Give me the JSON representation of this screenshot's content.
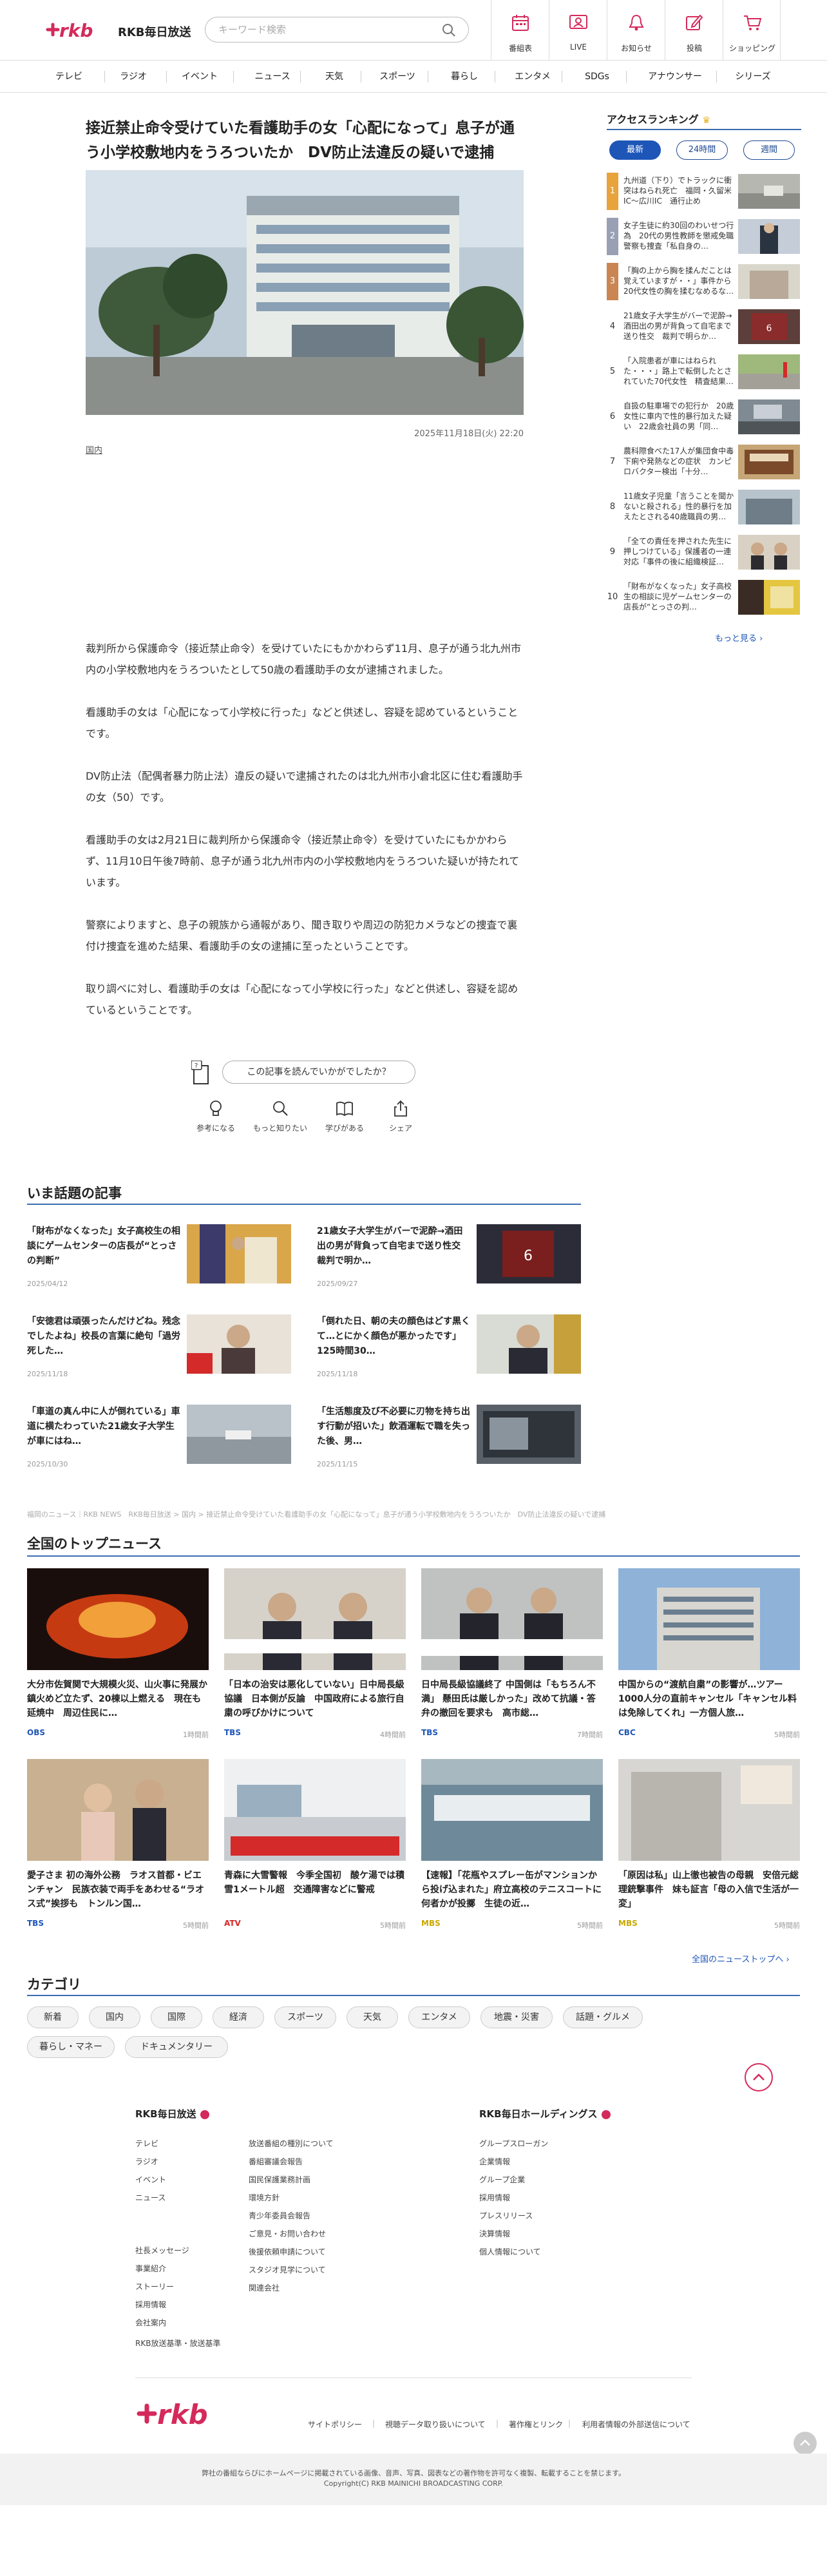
{
  "header": {
    "brand": "RKB毎日放送",
    "search_placeholder": "キーワード検索",
    "nav": [
      "番組表",
      "LIVE",
      "お知らせ",
      "投稿",
      "ショッピング"
    ]
  },
  "global_nav": [
    "テレビ",
    "ラジオ",
    "イベント",
    "ニュース",
    "天気",
    "スポーツ",
    "暮らし",
    "エンタメ",
    "SDGs",
    "アナウンサー",
    "シリーズ"
  ],
  "article": {
    "title": "接近禁止命令受けていた看護助手の女「心配になって」息子が通う小学校敷地内をうろついたか　DV防止法違反の疑いで逮捕",
    "date": "2025年11月18日(火) 22:20",
    "category": "国内",
    "paragraphs": [
      "裁判所から保護命令（接近禁止命令）を受けていたにもかかわらず11月、息子が通う北九州市内の小学校敷地内をうろついたとして50歳の看護助手の女が逮捕されました。",
      "看護助手の女は「心配になって小学校に行った」などと供述し、容疑を認めているということです。",
      "DV防止法（配偶者暴力防止法）違反の疑いで逮捕されたのは北九州市小倉北区に住む看護助手の女（50）です。",
      "看護助手の女は2月21日に裁判所から保護命令（接近禁止命令）を受けていたにもかかわらず、11月10日午後7時前、息子が通う北九州市内の小学校敷地内をうろついた疑いが持たれています。",
      "警察によりますと、息子の親族から通報があり、聞き取りや周辺の防犯カメラなどの捜査で裏付け捜査を進めた結果、看護助手の女の逮捕に至ったということです。",
      "取り調べに対し、看護助手の女は「心配になって小学校に行った」などと供述し、容疑を認めているということです。"
    ],
    "poll_question": "この記事を読んでいかがでしたか？",
    "reactions": [
      "参考になる",
      "もっと知りたい",
      "学びがある",
      "シェア"
    ]
  },
  "ranking": {
    "title": "アクセスランキング",
    "tabs": [
      "最新",
      "24時間",
      "週間"
    ],
    "active_tab": "最新",
    "items": [
      {
        "num": "1",
        "text": "九州道（下り）でトラックに衝突はねられ死亡　福岡・久留米IC～広川IC　通行止め"
      },
      {
        "num": "2",
        "text": "女子生徒に約30回のわいせつ行為　20代の男性教師を懲戒免職　警察も捜査「私自身の…"
      },
      {
        "num": "3",
        "text": "「胸の上から胸を揉んだことは覚えていますが・・」事件から20代女性の胸を揉むなめるな…"
      },
      {
        "num": "4",
        "text": "21歳女子大学生がバーで泥酔→酒田出の男が背負って自宅まで送り性交　裁判で明らか…"
      },
      {
        "num": "5",
        "text": "「入院患者が車にはねられた・・・」路上で転倒したとされていた70代女性　精査結果…"
      },
      {
        "num": "6",
        "text": "自扱の駐車場での犯行か　20歳女性に車内で性的暴行加えた疑い　22歳会社員の男「同…"
      },
      {
        "num": "7",
        "text": "農科際食べた17人が集団食中毒　下痢や発熱などの症状　カンピロバクター検出「十分…"
      },
      {
        "num": "8",
        "text": "11歳女子児童「言うことを聞かないと殺される」性的暴行を加えたとされる40歳職員の男…"
      },
      {
        "num": "9",
        "text": "「全ての責任を押された先生に押しつけている」保護者の一連対応「事件の後に組織検証…"
      },
      {
        "num": "10",
        "text": "「財布がなくなった」女子高校生の相談に児ゲームセンターの店長が“とっさの判…"
      }
    ],
    "more": "もっと見る"
  },
  "trending": {
    "title": "いま話題の記事",
    "items": [
      {
        "title": "「財布がなくなった」女子高校生の相談にゲームセンターの店長が“とっさの判断”",
        "date": "2025/04/12"
      },
      {
        "title": "21歳女子大学生がバーで泥酔→酒田出の男が背負って自宅まで送り性交　裁判で明か…",
        "date": "2025/09/27"
      },
      {
        "title": "「安徳君は頑張ったんだけどね。残念でしたよね」校長の言葉に絶句「過労死した…",
        "date": "2025/11/18"
      },
      {
        "title": "「倒れた日、朝の夫の顔色はどす黒くて…とにかく顔色が悪かったです」125時間30…",
        "date": "2025/11/18"
      },
      {
        "title": "「車道の真ん中に人が倒れている」車道に横たわっていた21歳女子大学生が車にはね…",
        "date": "2025/10/30"
      },
      {
        "title": "「生活態度及び不必要に刃物を持ち出す行動が招いた」飲酒運転で職を失った後、男…",
        "date": "2025/11/15"
      }
    ]
  },
  "breadcrumb": "福岡のニュース｜RKB NEWS　RKB毎日放送 > 国内 > 接近禁止命令受けていた看護助手の女「心配になって」息子が通う小学校敷地内をうろついたか　DV防止法違反の疑いで逮捕",
  "national": {
    "title": "全国のトップニュース",
    "items": [
      {
        "title": "大分市佐賀関で大規模火災、山火事に発展か　鎮火めど立たず、20棟以上燃える　現在も延焼中　周辺住民に…",
        "source": "OBS",
        "time": "1時間前",
        "color": "#1e56b8"
      },
      {
        "title": "「日本の治安は悪化していない」日中局長級協議　日本側が反論　中国政府による旅行自粛の呼びかけについて",
        "source": "TBS",
        "time": "4時間前",
        "color": "#1e56b8"
      },
      {
        "title": "日中局長級協議終了 中国側は「もちろん不満」 懸田氏は厳しかった」改めて抗議・答弁の撤回を要求も　高市総…",
        "source": "TBS",
        "time": "7時間前",
        "color": "#1e56b8"
      },
      {
        "title": "中国からの“渡航自粛”の影響が…ツアー1000人分の直前キャンセル「キャンセル料は免除してくれ」一方個人旅…",
        "source": "CBC",
        "time": "5時間前",
        "color": "#1e56b8"
      },
      {
        "title": "愛子さま 初の海外公務　ラオス首都・ビエンチャン　民族衣装で両手をあわせる“ラオス式”挨拶も　トンルン国…",
        "source": "TBS",
        "time": "5時間前",
        "color": "#1e56b8"
      },
      {
        "title": "青森に大雪警報　今季全国初　酸ケ湯では積雪1メートル超　交通障害などに警戒",
        "source": "ATV",
        "time": "5時間前",
        "color": "#d42a2a"
      },
      {
        "title": "【速報】「花瓶やスプレー缶がマンションから投げ込まれた」府立高校のテニスコートに何者かが投擲　生徒の近…",
        "source": "MBS",
        "time": "5時間前",
        "color": "#c9a800"
      },
      {
        "title": "「原因は私」山上徹也被告の母親　安倍元総理銃撃事件　妹も証言「母の入信で生活が一変」",
        "source": "MBS",
        "time": "5時間前",
        "color": "#c9a800"
      }
    ],
    "more": "全国のニューストップへ"
  },
  "categories": {
    "title": "カテゴリ",
    "items": [
      "新着",
      "国内",
      "国際",
      "経済",
      "スポーツ",
      "天気",
      "エンタメ",
      "地震・災害",
      "話題・グルメ",
      "暮らし・マネー",
      "ドキュメンタリー"
    ]
  },
  "footer": {
    "rkb_title": "RKB毎日放送",
    "rkb_col1": [
      "テレビ",
      "ラジオ",
      "イベント",
      "ニュース"
    ],
    "rkb_col1b": [
      "社長メッセージ",
      "事業紹介",
      "ストーリー",
      "採用情報",
      "会社案内"
    ],
    "rkb_col2": [
      "放送番組の種別について",
      "番組審議会報告",
      "国民保護業務計画",
      "環境方針",
      "青少年委員会報告",
      "ご意見・お問い合わせ",
      "後援依頼申請について",
      "スタジオ見学について",
      "関連会社"
    ],
    "rkb_col1c": [
      "RKB放送基準・放送基準"
    ],
    "hd_title": "RKB毎日ホールディングス",
    "hd_col": [
      "グループスローガン",
      "企業情報",
      "グループ企業",
      "採用情報",
      "プレスリリース",
      "決算情報",
      "個人情報について"
    ],
    "links": [
      "サイトポリシー",
      "視聴データ取り扱いについて",
      "著作権とリンク",
      "利用者情報の外部送信について"
    ],
    "copy1": "弊社の番組ならびにホームページに掲載されている画像、音声、写真、図表などの著作物を許可なく複製、転載することを禁じます。",
    "copy2": "Copyright(C) RKB MAINICHI BROADCASTING CORP."
  },
  "colors": {
    "brand_pink": "#d42a5b",
    "accent_blue": "#1e56b8",
    "rank_top": "#e8a33c"
  }
}
